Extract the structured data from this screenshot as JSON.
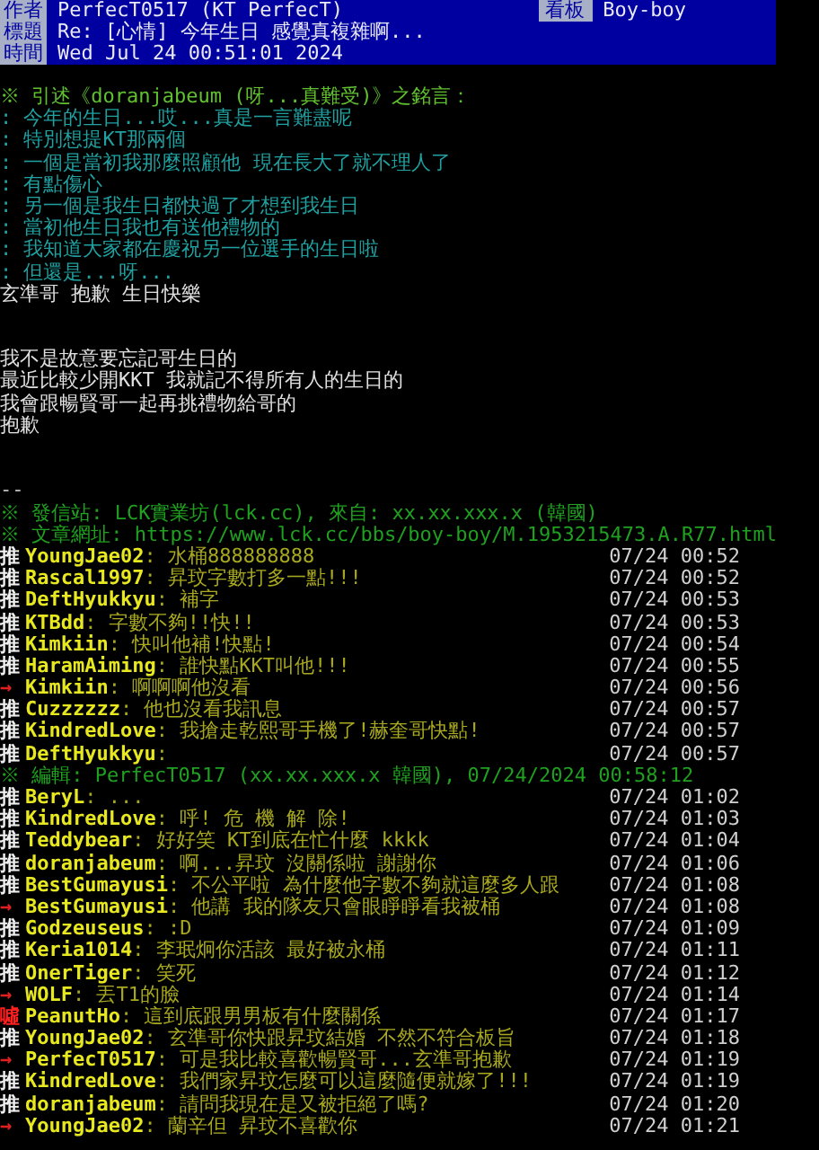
{
  "header": {
    "fields": [
      {
        "label": "作者",
        "value": "PerfecT0517 (KT PerfecT)"
      },
      {
        "label": "標題",
        "value": "Re: [心情] 今年生日 感覺真複雜啊..."
      },
      {
        "label": "時間",
        "value": "Wed Jul 24 00:51:01 2024"
      }
    ],
    "board_label": "看板",
    "board_value": "Boy-boy"
  },
  "quote": {
    "title": "※ 引述《doranjabeum (呀...真難受)》之銘言：",
    "lines": [
      ": 今年的生日...哎...真是一言難盡呢",
      ": 特別想提KT那兩個",
      ": 一個是當初我那麼照顧他 現在長大了就不理人了",
      ": 有點傷心",
      ": 另一個是我生日都快過了才想到我生日",
      ": 當初他生日我也有送他禮物的",
      ": 我知道大家都在慶祝另一位選手的生日啦",
      ": 但還是...呀..."
    ]
  },
  "reply": [
    "玄準哥 抱歉 生日快樂"
  ],
  "body": [
    "我不是故意要忘記哥生日的",
    "最近比較少開KKT 我就記不得所有人的生日的",
    "我會跟暢賢哥一起再挑禮物給哥的",
    "抱歉"
  ],
  "signature": {
    "separator": "--",
    "lines": [
      "※ 發信站: LCK實業坊(lck.cc), 來自: xx.xx.xxx.x (韓國)",
      "※ 文章網址: https://www.lck.cc/bbs/boy-boy/M.1953215473.A.R77.html"
    ]
  },
  "comments": [
    {
      "kind": "push",
      "tag": "推",
      "user": "YoungJae02",
      "content": ": 水桶888888888",
      "time": "07/24 00:52"
    },
    {
      "kind": "push",
      "tag": "推",
      "user": "Rascal1997",
      "content": ": 昇玟字數打多一點!!!",
      "time": "07/24 00:52"
    },
    {
      "kind": "push",
      "tag": "推",
      "user": "DeftHyukkyu",
      "content": ": 補字",
      "time": "07/24 00:53"
    },
    {
      "kind": "push",
      "tag": "推",
      "user": "KTBdd",
      "content": ": 字數不夠!!快!!",
      "time": "07/24 00:53"
    },
    {
      "kind": "push",
      "tag": "推",
      "user": "Kimkiin",
      "content": ": 快叫他補!快點!",
      "time": "07/24 00:54"
    },
    {
      "kind": "push",
      "tag": "推",
      "user": "HaramAiming",
      "content": ": 誰快點KKT叫他!!!",
      "time": "07/24 00:55"
    },
    {
      "kind": "arrow",
      "tag": "→",
      "user": "Kimkiin",
      "content": ": 啊啊啊他沒看",
      "time": "07/24 00:56"
    },
    {
      "kind": "push",
      "tag": "推",
      "user": "Cuzzzzzz",
      "content": ": 他也沒看我訊息",
      "time": "07/24 00:57"
    },
    {
      "kind": "push",
      "tag": "推",
      "user": "KindredLove",
      "content": ": 我搶走乾熙哥手機了!赫奎哥快點!",
      "time": "07/24 00:57"
    },
    {
      "kind": "push",
      "tag": "推",
      "user": "DeftHyukkyu",
      "content": ":",
      "time": "07/24 00:57"
    },
    {
      "kind": "edit",
      "text": "※ 編輯: PerfecT0517 (xx.xx.xxx.x 韓國), 07/24/2024 00:58:12"
    },
    {
      "kind": "push",
      "tag": "推",
      "user": "BeryL",
      "content": ": ...",
      "time": "07/24 01:02"
    },
    {
      "kind": "push",
      "tag": "推",
      "user": "KindredLove",
      "content": ": 呼! 危 機 解 除!",
      "time": "07/24 01:03"
    },
    {
      "kind": "push",
      "tag": "推",
      "user": "Teddybear",
      "content": ": 好好笑 KT到底在忙什麼 kkkk",
      "time": "07/24 01:04"
    },
    {
      "kind": "push",
      "tag": "推",
      "user": "doranjabeum",
      "content": ": 啊...昇玟 沒關係啦 謝謝你",
      "time": "07/24 01:06"
    },
    {
      "kind": "push",
      "tag": "推",
      "user": "BestGumayusi",
      "content": ": 不公平啦 為什麼他字數不夠就這麼多人跟",
      "time": "07/24 01:08"
    },
    {
      "kind": "arrow",
      "tag": "→",
      "user": "BestGumayusi",
      "content": ": 他講 我的隊友只會眼睜睜看我被桶",
      "time": "07/24 01:08"
    },
    {
      "kind": "push",
      "tag": "推",
      "user": "Godzeuseus",
      "content": ": :D",
      "time": "07/24 01:09"
    },
    {
      "kind": "push",
      "tag": "推",
      "user": "Keria1014",
      "content": ": 李珉炯你活該 最好被永桶",
      "time": "07/24 01:11"
    },
    {
      "kind": "push",
      "tag": "推",
      "user": "OnerTiger",
      "content": ": 笑死",
      "time": "07/24 01:12"
    },
    {
      "kind": "arrow",
      "tag": "→",
      "user": "WOLF",
      "content": ": 丟T1的臉",
      "time": "07/24 01:14"
    },
    {
      "kind": "boo",
      "tag": "噓",
      "user": "PeanutHo",
      "content": ": 這到底跟男男板有什麼關係",
      "time": "07/24 01:17"
    },
    {
      "kind": "push",
      "tag": "推",
      "user": "YoungJae02",
      "content": ": 玄準哥你快跟昇玟結婚 不然不符合板旨",
      "time": "07/24 01:18"
    },
    {
      "kind": "arrow",
      "tag": "→",
      "user": "PerfecT0517",
      "content": ": 可是我比較喜歡暢賢哥...玄準哥抱歉",
      "time": "07/24 01:19"
    },
    {
      "kind": "push",
      "tag": "推",
      "user": "KindredLove",
      "content": ": 我們家昇玟怎麼可以這麼隨便就嫁了!!!",
      "time": "07/24 01:19"
    },
    {
      "kind": "push",
      "tag": "推",
      "user": "doranjabeum",
      "content": ": 請問我現在是又被拒絕了嗎?",
      "time": "07/24 01:20"
    },
    {
      "kind": "arrow",
      "tag": "→",
      "user": "YoungJae02",
      "content": ": 蘭辛但 昇玟不喜歡你",
      "time": "07/24 01:21"
    }
  ]
}
